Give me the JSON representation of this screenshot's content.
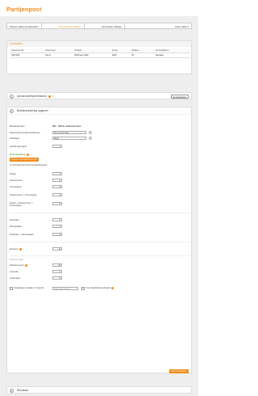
{
  "app": {
    "title": "Partijenpost"
  },
  "tabs": [
    {
      "label": "Nieuwe partij voorbereiden"
    },
    {
      "label": "Voorgemeten partijen"
    },
    {
      "label": "Verzonden partijen"
    }
  ],
  "help_label": "Hulp nodig ?",
  "contract_panel": {
    "title": "Contracten",
    "columns": [
      "Klantnummer",
      "Klantnaam",
      "Product",
      "Sorter",
      "Stadium",
      "Verzenddatum"
    ],
    "rows": [
      [
        "9457245",
        "demo",
        "DDD Euro Mail",
        "0000",
        "00",
        "Vandaag"
      ]
    ]
  },
  "step1": {
    "number": "1",
    "label": "Upload adressenbestand",
    "button": "ga aanpassen"
  },
  "step2": {
    "number": "2",
    "label": "Bestandsindeling opgeven"
  },
  "form": {
    "bestandsnaam_label": "Bestandsnaam",
    "bestandsnaam_value": "001 - 000 %. adressen.xlsx",
    "datum_label": "Datum/tijd formats bestelingen",
    "datum_value": "Kies een formaat",
    "werkblad_label": "Werkblad",
    "werkblad_value": "Blad1",
    "kopregels_label": "Aantal kopregels",
    "kopregels_value": "1",
    "kolom_title": "Kolomindeling",
    "kolom_button": "Indelen met kolomnummers",
    "kolom_sub": "of via kolomnummers bestandsregels",
    "fields": [
      {
        "label": "Straat",
        "value": "1"
      },
      {
        "label": "Huisnummer",
        "value": "2"
      },
      {
        "label": "Toevoeging",
        "value": "3"
      },
      {
        "label": "Huisnummer + Toevoeging",
        "value": "4"
      },
      {
        "label": "Straat + Huisnummer + Toevoeging",
        "value": "5"
      }
    ],
    "fields2": [
      {
        "label": "Postcode",
        "value": "6"
      },
      {
        "label": "Woonplaats",
        "value": "7"
      },
      {
        "label": "Postcode + Woonplaats",
        "value": "8"
      }
    ],
    "extra_label": "Extranet",
    "extra_value": "11",
    "gewicht_title": "Optionele velden",
    "fields3": [
      {
        "label": "Klantkenmerk",
        "value": "10"
      },
      {
        "label": "Lencode",
        "value": "1"
      },
      {
        "label": "Landnaam",
        "value": "5"
      }
    ],
    "opslaan_label": "Instellingen opslaan in favoriet",
    "opslaan_placeholder": "Naam van favoriet",
    "toon_label": "Toon bestandsvoorbeeld",
    "start_button": "Start verwerken"
  },
  "step3": {
    "number": "3",
    "label": "Resultaat"
  }
}
